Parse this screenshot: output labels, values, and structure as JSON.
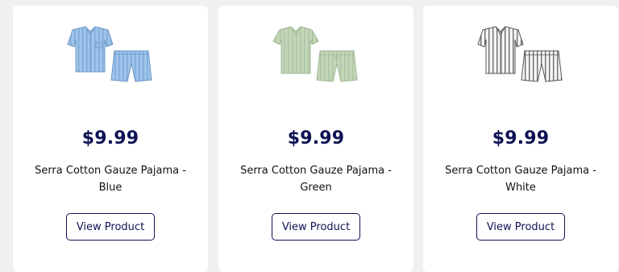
{
  "products": [
    {
      "price": "$9.99",
      "name": "Serra Cotton Gauze Pajama - Blue",
      "button": "View Product",
      "image_icon": "blue-pajama-set-image",
      "colors": {
        "main": "#9fc4ea",
        "stripe": "#6e98c8"
      }
    },
    {
      "price": "$9.99",
      "name": "Serra Cotton Gauze Pajama - Green",
      "button": "View Product",
      "image_icon": "green-pajama-set-image",
      "colors": {
        "main": "#bfd2b4",
        "stripe": "#9fb794"
      }
    },
    {
      "price": "$9.99",
      "name": "Serra Cotton Gauze Pajama - White",
      "button": "View Product",
      "image_icon": "white-striped-pajama-set-image",
      "colors": {
        "main": "#f2f2f2",
        "stripe": "#6e6e6e"
      }
    }
  ],
  "colors": {
    "brand": "#0d1254",
    "background": "#f0f0f3"
  }
}
